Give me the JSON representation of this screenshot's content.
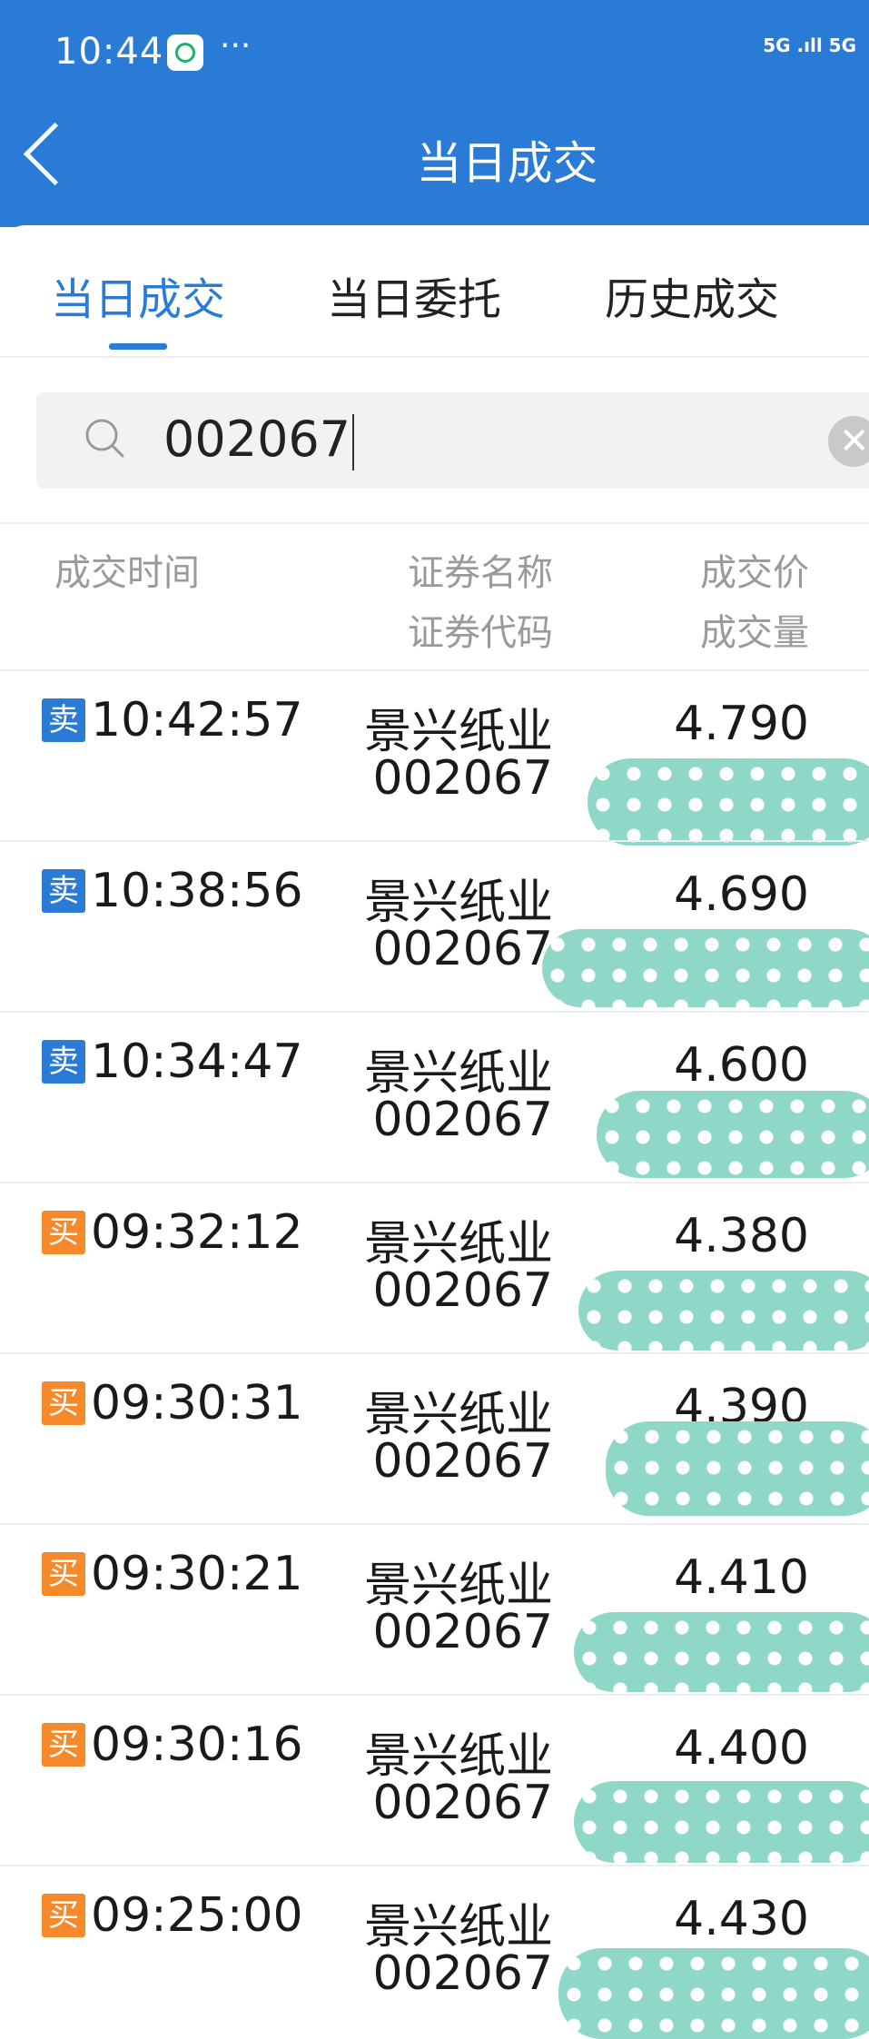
{
  "status_bar": {
    "time": "10:44",
    "dots": "···",
    "network": "5G .ıll 5G"
  },
  "header": {
    "title": "当日成交"
  },
  "tabs": [
    {
      "label": "当日成交",
      "active": true
    },
    {
      "label": "当日委托",
      "active": false
    },
    {
      "label": "历史成交",
      "active": false
    }
  ],
  "search": {
    "value": "002067"
  },
  "columns": {
    "time": "成交时间",
    "name": "证券名称",
    "code": "证券代码",
    "price": "成交价",
    "volume": "成交量"
  },
  "trades": [
    {
      "side": "卖",
      "type": "sell",
      "time": "10:42:57",
      "name": "景兴纸业",
      "code": "002067",
      "price": "4.790"
    },
    {
      "side": "卖",
      "type": "sell",
      "time": "10:38:56",
      "name": "景兴纸业",
      "code": "002067",
      "price": "4.690"
    },
    {
      "side": "卖",
      "type": "sell",
      "time": "10:34:47",
      "name": "景兴纸业",
      "code": "002067",
      "price": "4.600"
    },
    {
      "side": "买",
      "type": "buy",
      "time": "09:32:12",
      "name": "景兴纸业",
      "code": "002067",
      "price": "4.380"
    },
    {
      "side": "买",
      "type": "buy",
      "time": "09:30:31",
      "name": "景兴纸业",
      "code": "002067",
      "price": "4.390"
    },
    {
      "side": "买",
      "type": "buy",
      "time": "09:30:21",
      "name": "景兴纸业",
      "code": "002067",
      "price": "4.410"
    },
    {
      "side": "买",
      "type": "buy",
      "time": "09:30:16",
      "name": "景兴纸业",
      "code": "002067",
      "price": "4.400"
    },
    {
      "side": "买",
      "type": "buy",
      "time": "09:25:00",
      "name": "景兴纸业",
      "code": "002067",
      "price": "4.430"
    }
  ],
  "colors": {
    "brand_blue": "#2a7bd6",
    "sell_badge": "#2a7bd6",
    "buy_badge": "#f68a2a",
    "redaction_mask": "#8fd8c8"
  }
}
